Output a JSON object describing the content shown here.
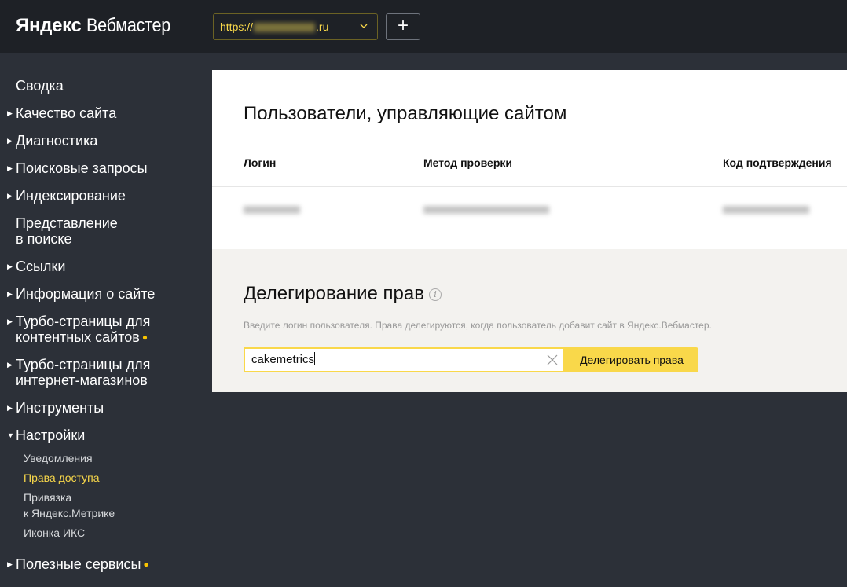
{
  "header": {
    "logo_brand": "Яндекс",
    "logo_product": "Вебмастер",
    "site_prefix": "https://",
    "site_suffix": ".ru",
    "add_label": "+"
  },
  "sidebar": {
    "items": [
      {
        "label": "Сводка"
      },
      {
        "label": "Качество сайта"
      },
      {
        "label": "Диагностика"
      },
      {
        "label": "Поисковые запросы"
      },
      {
        "label": "Индексирование"
      },
      {
        "label_line1": "Представление",
        "label_line2": "в поиске"
      },
      {
        "label": "Ссылки"
      },
      {
        "label": "Информация о сайте"
      },
      {
        "label_line1": "Турбо-страницы для",
        "label_line2": "контентных сайтов"
      },
      {
        "label_line1": "Турбо-страницы для",
        "label_line2": "интернет-магазинов"
      },
      {
        "label": "Инструменты"
      },
      {
        "label": "Настройки"
      },
      {
        "label": "Полезные сервисы"
      }
    ],
    "settings_sub": [
      {
        "label": "Уведомления"
      },
      {
        "label": "Права доступа"
      },
      {
        "label_line1": "Привязка",
        "label_line2": "к Яндекс.Метрике"
      },
      {
        "label": "Иконка ИКС"
      }
    ]
  },
  "users_section": {
    "title": "Пользователи, управляющие сайтом",
    "columns": [
      "Логин",
      "Метод проверки",
      "Код подтверждения"
    ]
  },
  "delegation": {
    "title": "Делегирование прав",
    "hint": "Введите логин пользователя. Права делегируются, когда пользователь добавит сайт в Яндекс.Вебмастер.",
    "input_value": "cakemetrics",
    "button_label": "Делегировать права"
  },
  "colors": {
    "accent": "#f9d84a",
    "topbar": "#1e2126",
    "sidebar": "#2c3038",
    "dot": "#f9c400"
  }
}
